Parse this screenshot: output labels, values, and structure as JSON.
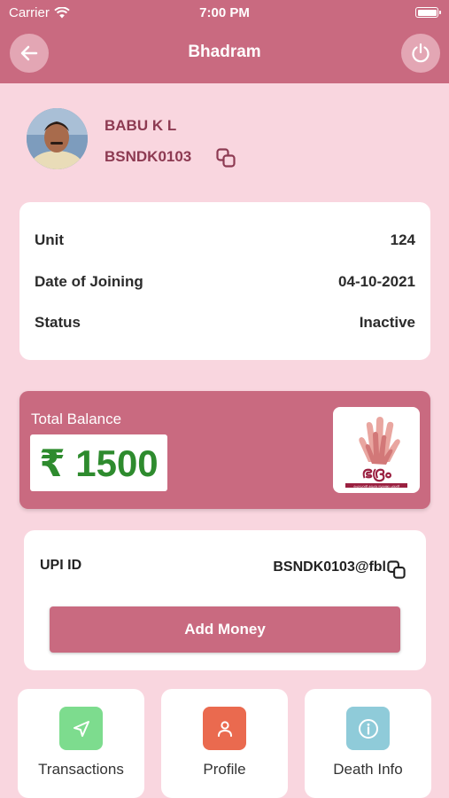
{
  "status_bar": {
    "carrier": "Carrier",
    "time": "7:00 PM"
  },
  "nav": {
    "title": "Bhadram",
    "back_icon": "back-arrow-icon",
    "power_icon": "power-icon"
  },
  "profile": {
    "name": "BABU K L",
    "member_id": "BSNDK0103"
  },
  "info": {
    "rows": [
      {
        "label": "Unit",
        "value": "124"
      },
      {
        "label": "Date of Joining",
        "value": "04-10-2021"
      },
      {
        "label": "Status",
        "value": "Inactive"
      }
    ]
  },
  "balance": {
    "label": "Total Balance",
    "amount": "₹ 1500",
    "logo_text": "ഭദ്രം",
    "logo_tagline": "ഫെഡറൽ കുടുംബ സുരക്ഷാ പദ്ധതി"
  },
  "upi": {
    "label": "UPI ID",
    "value": "BSNDK0103@fbl",
    "button": "Add Money"
  },
  "tiles": [
    {
      "label": "Transactions",
      "icon": "navigation-arrow-icon",
      "color": "#7ddc8e"
    },
    {
      "label": "Profile",
      "icon": "person-icon",
      "color": "#ea6a4f"
    },
    {
      "label": "Death Info",
      "icon": "info-icon",
      "color": "#8fcbd9"
    }
  ],
  "colors": {
    "primary": "#c96a80",
    "background": "#f9d6df",
    "amount_green": "#2e8b2e"
  }
}
